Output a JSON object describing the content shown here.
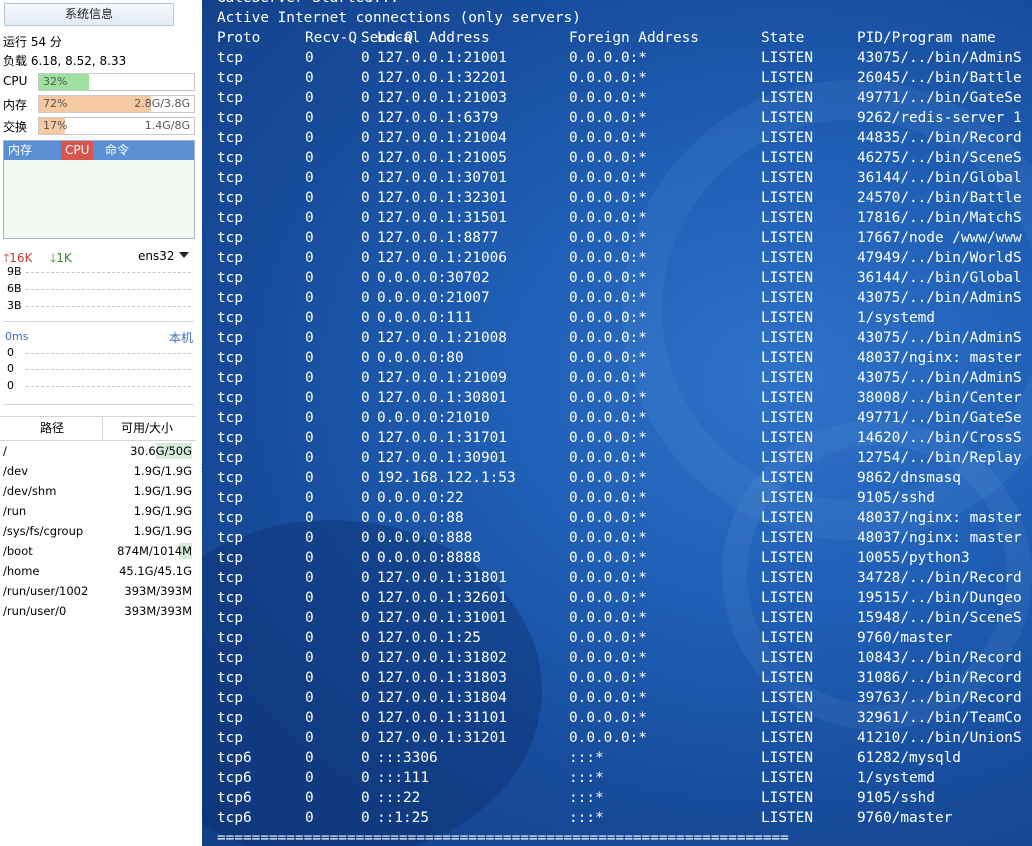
{
  "sidebar": {
    "title_button": "系统信息",
    "uptime": "运行 54 分",
    "load": "负载 6.18, 8.52, 8.33",
    "meters": [
      {
        "label": "CPU",
        "percent_text": "32%",
        "fraction": 0.32,
        "size": "",
        "color": "#9ee09e"
      },
      {
        "label": "内存",
        "percent_text": "72%",
        "fraction": 0.72,
        "size": "2.8G/3.8G",
        "color": "#f6c9a3"
      },
      {
        "label": "交换",
        "percent_text": "17%",
        "fraction": 0.17,
        "size": "1.4G/8G",
        "color": "#f6c9a3"
      }
    ],
    "process_tabs": {
      "mem": "内存",
      "cpu": "CPU",
      "cmd": "命令"
    },
    "network": {
      "up": "16K",
      "down": "1K",
      "interface": "ens32",
      "scale": [
        "9B",
        "6B",
        "3B"
      ]
    },
    "ping": {
      "latency": "0ms",
      "target": "本机",
      "values": [
        "0",
        "0",
        "0"
      ]
    },
    "disk": {
      "headers": {
        "path": "路径",
        "avail": "可用/大小"
      },
      "rows": [
        {
          "path": "/",
          "value": "30.6G/50G",
          "used": 0.39
        },
        {
          "path": "/dev",
          "value": "1.9G/1.9G",
          "used": 0
        },
        {
          "path": "/dev/shm",
          "value": "1.9G/1.9G",
          "used": 0
        },
        {
          "path": "/run",
          "value": "1.9G/1.9G",
          "used": 0
        },
        {
          "path": "/sys/fs/cgroup",
          "value": "1.9G/1.9G",
          "used": 0
        },
        {
          "path": "/boot",
          "value": "874M/1014M",
          "used": 0.14
        },
        {
          "path": "/home",
          "value": "45.1G/45.1G",
          "used": 0
        },
        {
          "path": "/run/user/1002",
          "value": "393M/393M",
          "used": 0
        },
        {
          "path": "/run/user/0",
          "value": "393M/393M",
          "used": 0
        }
      ]
    }
  },
  "terminal": {
    "top_line": "GateServer Started...",
    "heading": "Active Internet connections (only servers)",
    "columns": [
      "Proto",
      "Recv-Q",
      "Send-Q",
      "Local Address",
      "Foreign Address",
      "State",
      "PID/Program name"
    ],
    "rows": [
      [
        "tcp",
        "0",
        "0",
        "127.0.0.1:21001",
        "0.0.0.0:*",
        "LISTEN",
        "43075/../bin/AdminS"
      ],
      [
        "tcp",
        "0",
        "0",
        "127.0.0.1:32201",
        "0.0.0.0:*",
        "LISTEN",
        "26045/../bin/Battle"
      ],
      [
        "tcp",
        "0",
        "0",
        "127.0.0.1:21003",
        "0.0.0.0:*",
        "LISTEN",
        "49771/../bin/GateSe"
      ],
      [
        "tcp",
        "0",
        "0",
        "127.0.0.1:6379",
        "0.0.0.0:*",
        "LISTEN",
        "9262/redis-server 1"
      ],
      [
        "tcp",
        "0",
        "0",
        "127.0.0.1:21004",
        "0.0.0.0:*",
        "LISTEN",
        "44835/../bin/Record"
      ],
      [
        "tcp",
        "0",
        "0",
        "127.0.0.1:21005",
        "0.0.0.0:*",
        "LISTEN",
        "46275/../bin/SceneS"
      ],
      [
        "tcp",
        "0",
        "0",
        "127.0.0.1:30701",
        "0.0.0.0:*",
        "LISTEN",
        "36144/../bin/Global"
      ],
      [
        "tcp",
        "0",
        "0",
        "127.0.0.1:32301",
        "0.0.0.0:*",
        "LISTEN",
        "24570/../bin/Battle"
      ],
      [
        "tcp",
        "0",
        "0",
        "127.0.0.1:31501",
        "0.0.0.0:*",
        "LISTEN",
        "17816/../bin/MatchS"
      ],
      [
        "tcp",
        "0",
        "0",
        "127.0.0.1:8877",
        "0.0.0.0:*",
        "LISTEN",
        "17667/node /www/www"
      ],
      [
        "tcp",
        "0",
        "0",
        "127.0.0.1:21006",
        "0.0.0.0:*",
        "LISTEN",
        "47949/../bin/WorldS"
      ],
      [
        "tcp",
        "0",
        "0",
        "0.0.0.0:30702",
        "0.0.0.0:*",
        "LISTEN",
        "36144/../bin/Global"
      ],
      [
        "tcp",
        "0",
        "0",
        "0.0.0.0:21007",
        "0.0.0.0:*",
        "LISTEN",
        "43075/../bin/AdminS"
      ],
      [
        "tcp",
        "0",
        "0",
        "0.0.0.0:111",
        "0.0.0.0:*",
        "LISTEN",
        "1/systemd"
      ],
      [
        "tcp",
        "0",
        "0",
        "127.0.0.1:21008",
        "0.0.0.0:*",
        "LISTEN",
        "43075/../bin/AdminS"
      ],
      [
        "tcp",
        "0",
        "0",
        "0.0.0.0:80",
        "0.0.0.0:*",
        "LISTEN",
        "48037/nginx: master"
      ],
      [
        "tcp",
        "0",
        "0",
        "127.0.0.1:21009",
        "0.0.0.0:*",
        "LISTEN",
        "43075/../bin/AdminS"
      ],
      [
        "tcp",
        "0",
        "0",
        "127.0.0.1:30801",
        "0.0.0.0:*",
        "LISTEN",
        "38008/../bin/Center"
      ],
      [
        "tcp",
        "0",
        "0",
        "0.0.0.0:21010",
        "0.0.0.0:*",
        "LISTEN",
        "49771/../bin/GateSe"
      ],
      [
        "tcp",
        "0",
        "0",
        "127.0.0.1:31701",
        "0.0.0.0:*",
        "LISTEN",
        "14620/../bin/CrossS"
      ],
      [
        "tcp",
        "0",
        "0",
        "127.0.0.1:30901",
        "0.0.0.0:*",
        "LISTEN",
        "12754/../bin/Replay"
      ],
      [
        "tcp",
        "0",
        "0",
        "192.168.122.1:53",
        "0.0.0.0:*",
        "LISTEN",
        "9862/dnsmasq"
      ],
      [
        "tcp",
        "0",
        "0",
        "0.0.0.0:22",
        "0.0.0.0:*",
        "LISTEN",
        "9105/sshd"
      ],
      [
        "tcp",
        "0",
        "0",
        "0.0.0.0:88",
        "0.0.0.0:*",
        "LISTEN",
        "48037/nginx: master"
      ],
      [
        "tcp",
        "0",
        "0",
        "0.0.0.0:888",
        "0.0.0.0:*",
        "LISTEN",
        "48037/nginx: master"
      ],
      [
        "tcp",
        "0",
        "0",
        "0.0.0.0:8888",
        "0.0.0.0:*",
        "LISTEN",
        "10055/python3"
      ],
      [
        "tcp",
        "0",
        "0",
        "127.0.0.1:31801",
        "0.0.0.0:*",
        "LISTEN",
        "34728/../bin/Record"
      ],
      [
        "tcp",
        "0",
        "0",
        "127.0.0.1:32601",
        "0.0.0.0:*",
        "LISTEN",
        "19515/../bin/Dungeo"
      ],
      [
        "tcp",
        "0",
        "0",
        "127.0.0.1:31001",
        "0.0.0.0:*",
        "LISTEN",
        "15948/../bin/SceneS"
      ],
      [
        "tcp",
        "0",
        "0",
        "127.0.0.1:25",
        "0.0.0.0:*",
        "LISTEN",
        "9760/master"
      ],
      [
        "tcp",
        "0",
        "0",
        "127.0.0.1:31802",
        "0.0.0.0:*",
        "LISTEN",
        "10843/../bin/Record"
      ],
      [
        "tcp",
        "0",
        "0",
        "127.0.0.1:31803",
        "0.0.0.0:*",
        "LISTEN",
        "31086/../bin/Record"
      ],
      [
        "tcp",
        "0",
        "0",
        "127.0.0.1:31804",
        "0.0.0.0:*",
        "LISTEN",
        "39763/../bin/Record"
      ],
      [
        "tcp",
        "0",
        "0",
        "127.0.0.1:31101",
        "0.0.0.0:*",
        "LISTEN",
        "32961/../bin/TeamCo"
      ],
      [
        "tcp",
        "0",
        "0",
        "127.0.0.1:31201",
        "0.0.0.0:*",
        "LISTEN",
        "41210/../bin/UnionS"
      ],
      [
        "tcp6",
        "0",
        "0",
        ":::3306",
        ":::*",
        "LISTEN",
        "61282/mysqld"
      ],
      [
        "tcp6",
        "0",
        "0",
        ":::111",
        ":::*",
        "LISTEN",
        "1/systemd"
      ],
      [
        "tcp6",
        "0",
        "0",
        ":::22",
        ":::*",
        "LISTEN",
        "9105/sshd"
      ],
      [
        "tcp6",
        "0",
        "0",
        "::1:25",
        ":::*",
        "LISTEN",
        "9760/master"
      ]
    ],
    "footer_rule": "=================================================================="
  }
}
